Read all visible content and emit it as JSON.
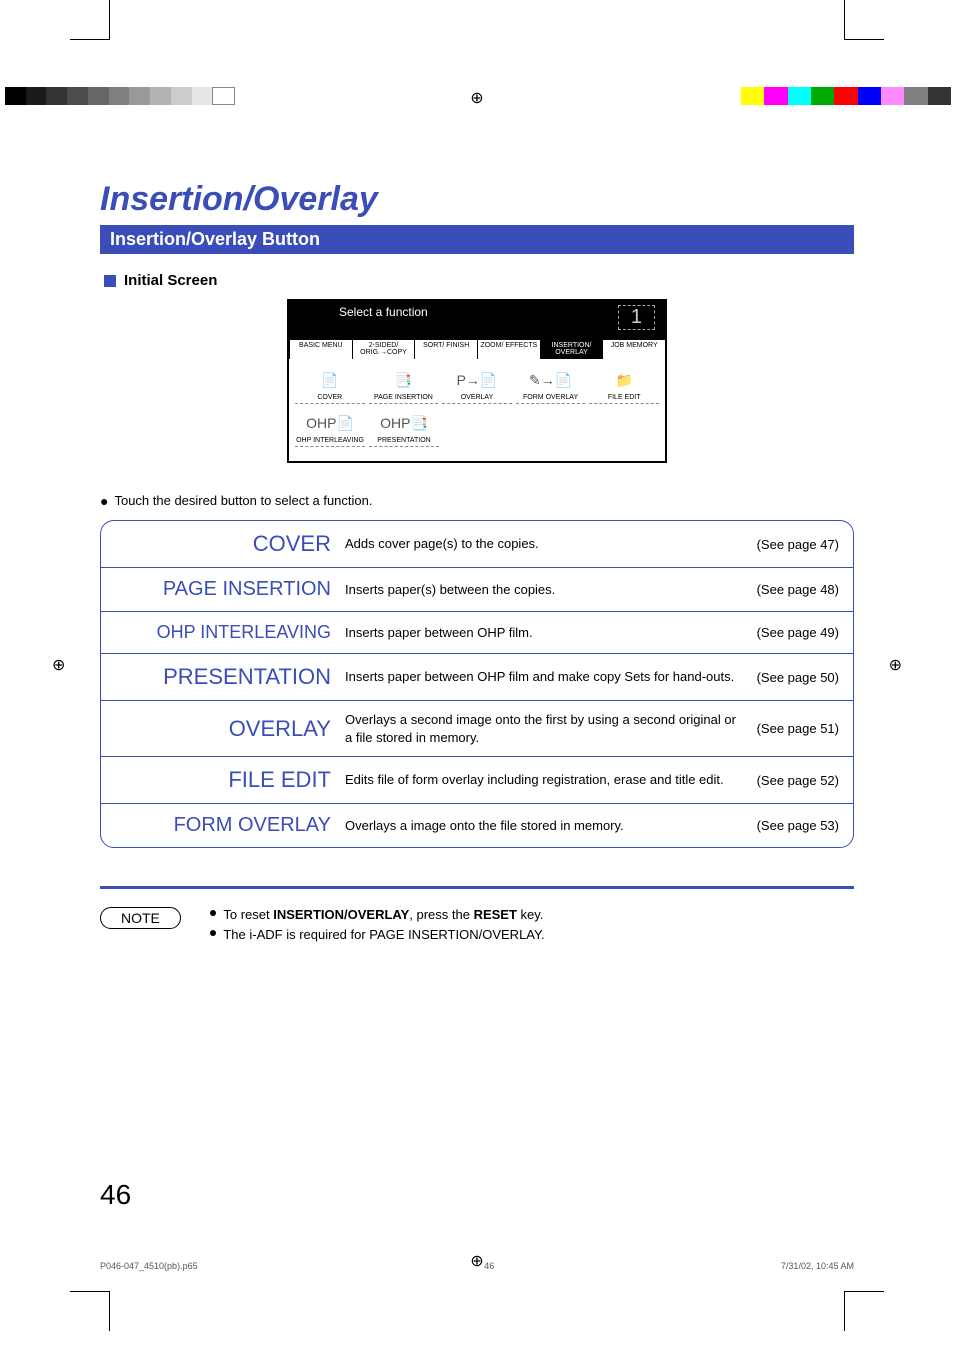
{
  "title": "Insertion/Overlay",
  "section_bar": "Insertion/Overlay Button",
  "subhead": "Initial Screen",
  "screen": {
    "prompt": "Select a function",
    "copy_count": "1",
    "tabs": [
      {
        "label": "BASIC MENU"
      },
      {
        "label": "2-SIDED/\nORIG.→COPY"
      },
      {
        "label": "SORT/\nFINISH"
      },
      {
        "label": "ZOOM/\nEFFECTS"
      },
      {
        "label": "INSERTION/\nOVERLAY",
        "active": true
      },
      {
        "label": "JOB\nMEMORY"
      }
    ],
    "buttons_row1": [
      {
        "name": "COVER",
        "icon": "📄"
      },
      {
        "name": "PAGE\nINSERTION",
        "icon": "📑"
      },
      {
        "name": "OVERLAY",
        "icon": "P→📄"
      },
      {
        "name": "FORM OVERLAY",
        "icon": "✎→📄"
      },
      {
        "name": "FILE EDIT",
        "icon": "📁"
      }
    ],
    "buttons_row2": [
      {
        "name": "OHP\nINTERLEAVING",
        "icon": "OHP📄"
      },
      {
        "name": "PRESENTATION",
        "icon": "OHP📑"
      }
    ]
  },
  "touch_line": "Touch the desired button to select a function.",
  "functions": [
    {
      "name": "COVER",
      "desc": "Adds cover page(s) to the copies.",
      "page": "(See page 47)"
    },
    {
      "name": "PAGE INSERTION",
      "desc": "Inserts paper(s) between the copies.",
      "page": "(See page 48)"
    },
    {
      "name": "OHP INTERLEAVING",
      "desc": "Inserts paper between OHP film.",
      "page": "(See page 49)"
    },
    {
      "name": "PRESENTATION",
      "desc": "Inserts paper between OHP film and make copy Sets for hand-outs.",
      "page": "(See page 50)"
    },
    {
      "name": "OVERLAY",
      "desc": "Overlays a second image onto the first by using a second original or a file stored in memory.",
      "page": "(See page 51)"
    },
    {
      "name": "FILE EDIT",
      "desc": "Edits file of form overlay including registration, erase and title edit.",
      "page": "(See page 52)"
    },
    {
      "name": "FORM OVERLAY",
      "desc": "Overlays a image onto the file stored in memory.",
      "page": "(See page 53)"
    }
  ],
  "note_label": "NOTE",
  "note_lines": [
    {
      "pre": "To reset ",
      "bold1": "INSERTION/OVERLAY",
      "mid": ", press the ",
      "bold2": "RESET",
      "post": " key."
    },
    {
      "plain": "The i-ADF is required for PAGE INSERTION/OVERLAY."
    }
  ],
  "page_number": "46",
  "footer": {
    "file": "P046-047_4510(pb).p65",
    "pg": "46",
    "date": "7/31/02, 10:45 AM"
  }
}
